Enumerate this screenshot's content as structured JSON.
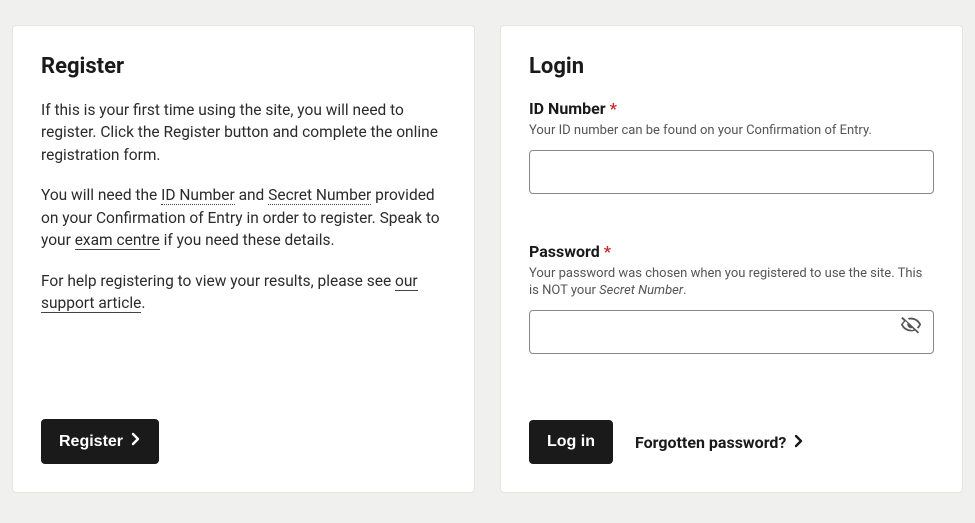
{
  "register": {
    "title": "Register",
    "intro": "If this is your first time using the site, you will need to register. Click the Register button and complete the online registration form.",
    "p2_a": "You will need the ",
    "p2_id": "ID Number",
    "p2_b": " and ",
    "p2_secret": "Secret Number",
    "p2_c": " provided on your Confirmation of Entry in order to register. Speak to your ",
    "p2_exam": "exam centre",
    "p2_d": " if you need these details.",
    "p3_a": "For help registering to view your results, please see ",
    "p3_link": "our support article",
    "p3_b": ".",
    "button": "Register"
  },
  "login": {
    "title": "Login",
    "id_label": "ID Number",
    "id_hint": "Your ID number can be found on your Confirmation of Entry.",
    "id_value": "",
    "pw_label": "Password",
    "pw_hint_a": "Your password was chosen when you registered to use the site. This is NOT your ",
    "pw_hint_em": "Secret Number",
    "pw_hint_b": ".",
    "pw_value": "",
    "button": "Log in",
    "forgot": "Forgotten password?",
    "required_marker": "*"
  }
}
